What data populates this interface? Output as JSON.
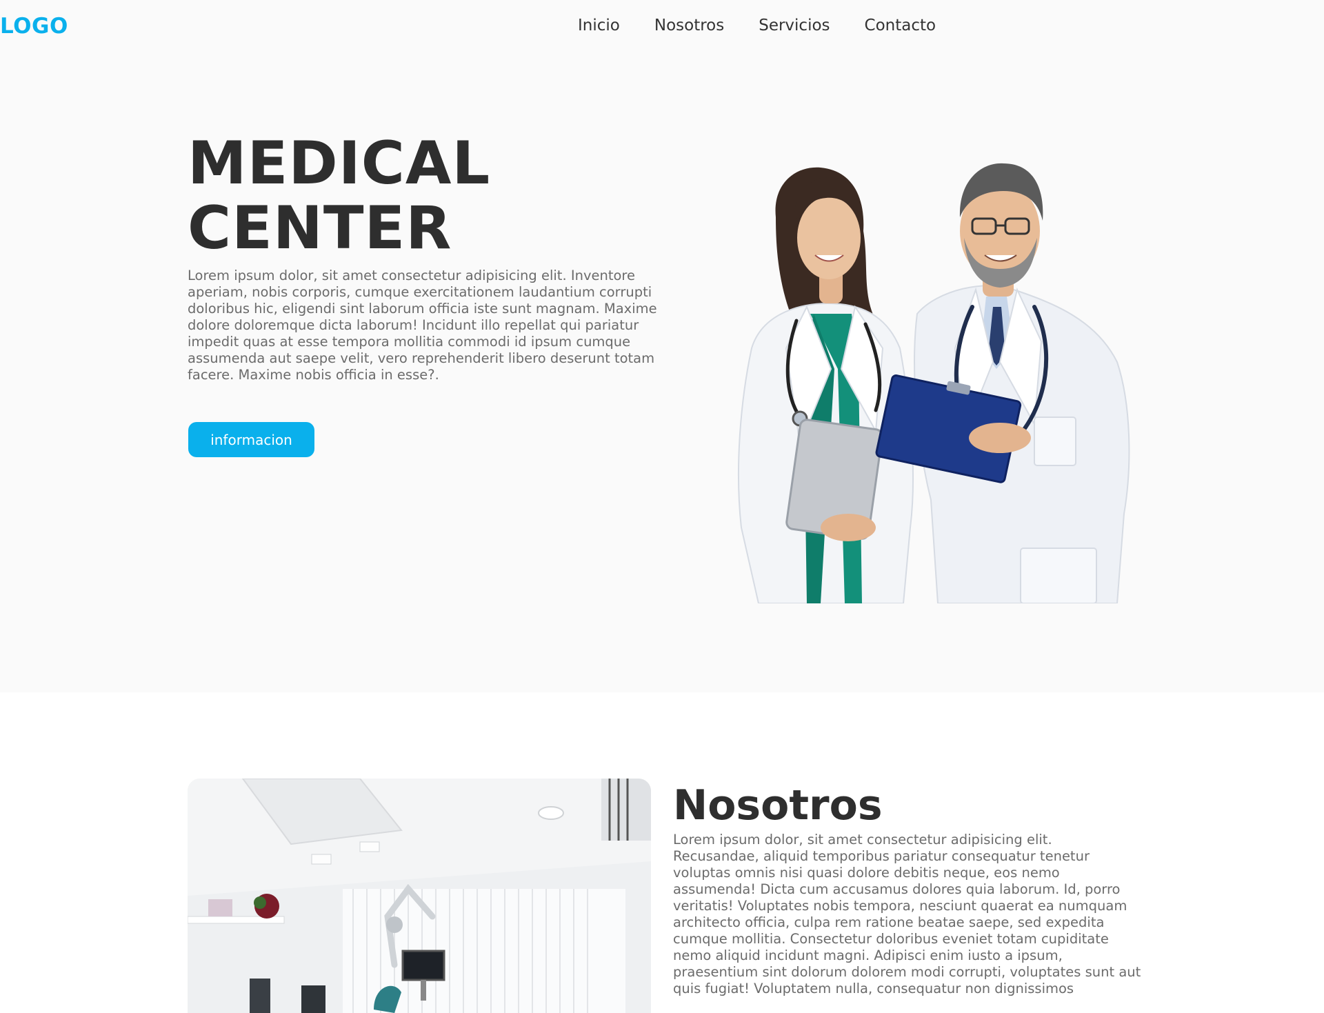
{
  "header": {
    "logo": "LOGO",
    "nav": [
      {
        "label": "Inicio"
      },
      {
        "label": "Nosotros"
      },
      {
        "label": "Servicios"
      },
      {
        "label": "Contacto"
      }
    ]
  },
  "hero": {
    "title_line1": "MEDICAL",
    "title_line2": "CENTER",
    "text": "Lorem ipsum dolor, sit amet consectetur adipisicing elit. Inventore aperiam, nobis corporis, cumque exercitationem laudantium corrupti doloribus hic, eligendi sint laborum officia iste sunt magnam. Maxime dolore doloremque dicta laborum! Incidunt illo repellat qui pariatur impedit quas at esse tempora mollitia commodi id ipsum cumque assumenda aut saepe velit, vero reprehenderit libero deserunt totam facere. Maxime nobis officia in esse?.",
    "button_label": "informacion"
  },
  "about": {
    "title": "Nosotros",
    "text": "Lorem ipsum dolor, sit amet consectetur adipisicing elit. Recusandae, aliquid temporibus pariatur consequatur tenetur voluptas omnis nisi quasi dolore debitis neque, eos nemo assumenda! Dicta cum accusamus dolores quia laborum. Id, porro veritatis! Voluptates nobis tempora, nesciunt quaerat ea numquam architecto officia, culpa rem ratione beatae saepe, sed expedita cumque mollitia. Consectetur doloribus eveniet totam cupiditate nemo aliquid incidunt magni. Adipisci enim iusto a ipsum, praesentium sint dolorum dolorem modi corrupti, voluptates sunt aut quis fugiat! Voluptatem nulla, consequatur non dignissimos"
  },
  "colors": {
    "accent": "#0ab0ec",
    "heading": "#2e2e2e",
    "body_text": "#6b6b6b",
    "hero_bg": "#fafafa"
  }
}
